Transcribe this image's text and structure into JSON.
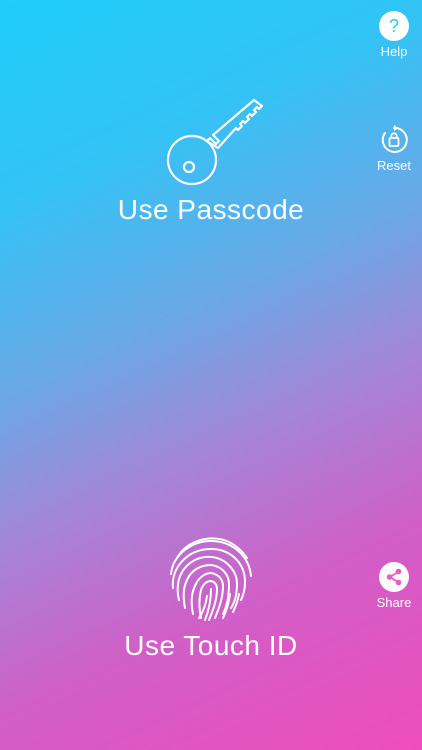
{
  "sidebar": {
    "help_label": "Help",
    "reset_label": "Reset",
    "share_label": "Share",
    "icons": {
      "help": "question-mark-circle-icon",
      "reset": "lock-reset-circle-icon",
      "share": "share-circle-icon"
    }
  },
  "main": {
    "passcode_label": "Use Passcode",
    "touchid_label": "Use Touch ID",
    "icons": {
      "passcode": "key-icon",
      "touchid": "fingerprint-icon"
    }
  },
  "colors": {
    "gradient_top": "#1fcdfb",
    "gradient_bottom": "#ef4dbd",
    "foreground": "#ffffff"
  }
}
